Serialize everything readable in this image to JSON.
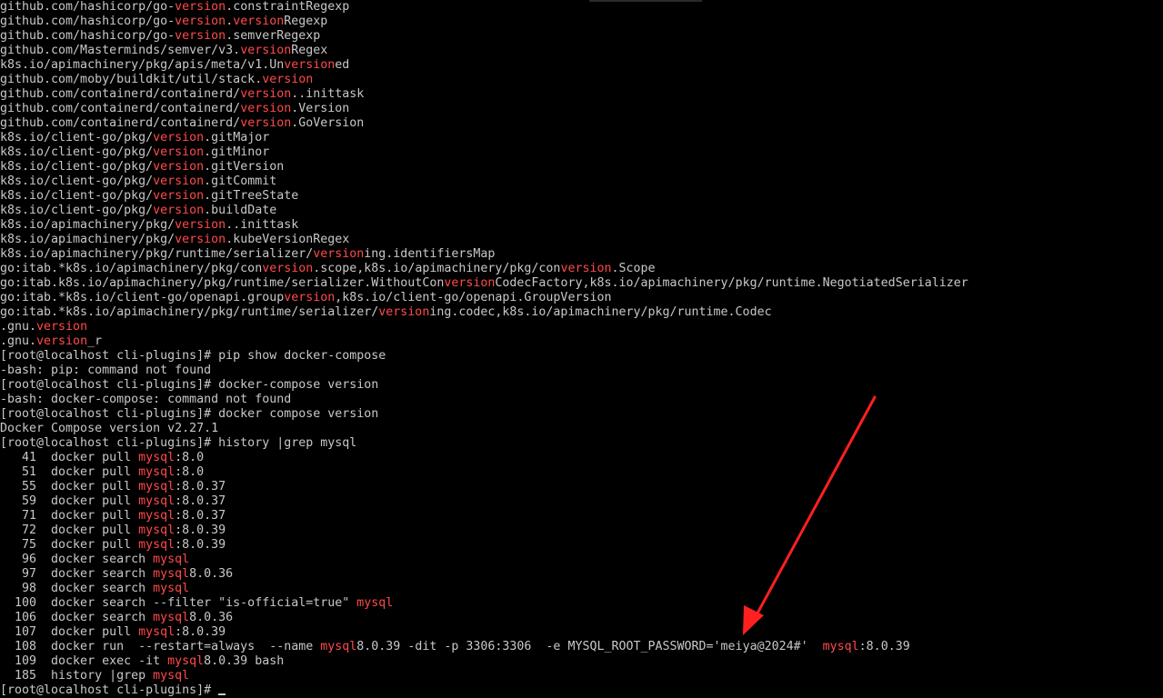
{
  "colors": {
    "background": "#000000",
    "text": "#c8c8c8",
    "highlight": "#ff4a4a",
    "arrow": "#ff2020"
  },
  "terminal": {
    "lines": [
      [
        {
          "t": "github.com/hashicorp/go-"
        },
        {
          "t": "version",
          "h": true
        },
        {
          "t": ".constraintRegexp"
        }
      ],
      [
        {
          "t": "github.com/hashicorp/go-"
        },
        {
          "t": "version",
          "h": true
        },
        {
          "t": "."
        },
        {
          "t": "version",
          "h": true
        },
        {
          "t": "Regexp"
        }
      ],
      [
        {
          "t": "github.com/hashicorp/go-"
        },
        {
          "t": "version",
          "h": true
        },
        {
          "t": ".semverRegexp"
        }
      ],
      [
        {
          "t": "github.com/Masterminds/semver/v3."
        },
        {
          "t": "version",
          "h": true
        },
        {
          "t": "Regex"
        }
      ],
      [
        {
          "t": "k8s.io/apimachinery/pkg/apis/meta/v1.Un"
        },
        {
          "t": "version",
          "h": true
        },
        {
          "t": "ed"
        }
      ],
      [
        {
          "t": "github.com/moby/buildkit/util/stack."
        },
        {
          "t": "version",
          "h": true
        }
      ],
      [
        {
          "t": "github.com/containerd/containerd/"
        },
        {
          "t": "version",
          "h": true
        },
        {
          "t": "..inittask"
        }
      ],
      [
        {
          "t": "github.com/containerd/containerd/"
        },
        {
          "t": "version",
          "h": true
        },
        {
          "t": ".Version"
        }
      ],
      [
        {
          "t": "github.com/containerd/containerd/"
        },
        {
          "t": "version",
          "h": true
        },
        {
          "t": ".GoVersion"
        }
      ],
      [
        {
          "t": "k8s.io/client-go/pkg/"
        },
        {
          "t": "version",
          "h": true
        },
        {
          "t": ".gitMajor"
        }
      ],
      [
        {
          "t": "k8s.io/client-go/pkg/"
        },
        {
          "t": "version",
          "h": true
        },
        {
          "t": ".gitMinor"
        }
      ],
      [
        {
          "t": "k8s.io/client-go/pkg/"
        },
        {
          "t": "version",
          "h": true
        },
        {
          "t": ".gitVersion"
        }
      ],
      [
        {
          "t": "k8s.io/client-go/pkg/"
        },
        {
          "t": "version",
          "h": true
        },
        {
          "t": ".gitCommit"
        }
      ],
      [
        {
          "t": "k8s.io/client-go/pkg/"
        },
        {
          "t": "version",
          "h": true
        },
        {
          "t": ".gitTreeState"
        }
      ],
      [
        {
          "t": "k8s.io/client-go/pkg/"
        },
        {
          "t": "version",
          "h": true
        },
        {
          "t": ".buildDate"
        }
      ],
      [
        {
          "t": "k8s.io/apimachinery/pkg/"
        },
        {
          "t": "version",
          "h": true
        },
        {
          "t": "..inittask"
        }
      ],
      [
        {
          "t": "k8s.io/apimachinery/pkg/"
        },
        {
          "t": "version",
          "h": true
        },
        {
          "t": ".kubeVersionRegex"
        }
      ],
      [
        {
          "t": "k8s.io/apimachinery/pkg/runtime/serializer/"
        },
        {
          "t": "version",
          "h": true
        },
        {
          "t": "ing.identifiersMap"
        }
      ],
      [
        {
          "t": "go:itab.*k8s.io/apimachinery/pkg/con"
        },
        {
          "t": "version",
          "h": true
        },
        {
          "t": ".scope,k8s.io/apimachinery/pkg/con"
        },
        {
          "t": "version",
          "h": true
        },
        {
          "t": ".Scope"
        }
      ],
      [
        {
          "t": "go:itab.k8s.io/apimachinery/pkg/runtime/serializer.WithoutCon"
        },
        {
          "t": "version",
          "h": true
        },
        {
          "t": "CodecFactory,k8s.io/apimachinery/pkg/runtime.NegotiatedSerializer"
        }
      ],
      [
        {
          "t": "go:itab.*k8s.io/client-go/openapi.group"
        },
        {
          "t": "version",
          "h": true
        },
        {
          "t": ",k8s.io/client-go/openapi.GroupVersion"
        }
      ],
      [
        {
          "t": "go:itab.*k8s.io/apimachinery/pkg/runtime/serializer/"
        },
        {
          "t": "version",
          "h": true
        },
        {
          "t": "ing.codec,k8s.io/apimachinery/pkg/runtime.Codec"
        }
      ],
      [
        {
          "t": ".gnu."
        },
        {
          "t": "version",
          "h": true
        }
      ],
      [
        {
          "t": ".gnu."
        },
        {
          "t": "version",
          "h": true
        },
        {
          "t": "_r"
        }
      ],
      [
        {
          "t": "[root@localhost cli-plugins]# pip show docker-compose"
        }
      ],
      [
        {
          "t": "-bash: pip: command not found"
        }
      ],
      [
        {
          "t": "[root@localhost cli-plugins]# docker-compose version"
        }
      ],
      [
        {
          "t": "-bash: docker-compose: command not found"
        }
      ],
      [
        {
          "t": "[root@localhost cli-plugins]# docker compose version"
        }
      ],
      [
        {
          "t": "Docker Compose version v2.27.1"
        }
      ],
      [
        {
          "t": "[root@localhost cli-plugins]# history |grep mysql"
        }
      ],
      [
        {
          "t": "   41  docker pull "
        },
        {
          "t": "mysql",
          "h": true
        },
        {
          "t": ":8.0"
        }
      ],
      [
        {
          "t": "   51  docker pull "
        },
        {
          "t": "mysql",
          "h": true
        },
        {
          "t": ":8.0"
        }
      ],
      [
        {
          "t": "   55  docker pull "
        },
        {
          "t": "mysql",
          "h": true
        },
        {
          "t": ":8.0.37"
        }
      ],
      [
        {
          "t": "   59  docker pull "
        },
        {
          "t": "mysql",
          "h": true
        },
        {
          "t": ":8.0.37"
        }
      ],
      [
        {
          "t": "   71  docker pull "
        },
        {
          "t": "mysql",
          "h": true
        },
        {
          "t": ":8.0.37"
        }
      ],
      [
        {
          "t": "   72  docker pull "
        },
        {
          "t": "mysql",
          "h": true
        },
        {
          "t": ":8.0.39"
        }
      ],
      [
        {
          "t": "   75  docker pull "
        },
        {
          "t": "mysql",
          "h": true
        },
        {
          "t": ":8.0.39"
        }
      ],
      [
        {
          "t": "   96  docker search "
        },
        {
          "t": "mysql",
          "h": true
        }
      ],
      [
        {
          "t": "   97  docker search "
        },
        {
          "t": "mysql",
          "h": true
        },
        {
          "t": "8.0.36"
        }
      ],
      [
        {
          "t": "   98  docker search "
        },
        {
          "t": "mysql",
          "h": true
        }
      ],
      [
        {
          "t": "  100  docker search --filter \"is-official=true\" "
        },
        {
          "t": "mysql",
          "h": true
        }
      ],
      [
        {
          "t": "  106  docker search "
        },
        {
          "t": "mysql",
          "h": true
        },
        {
          "t": "8.0.36"
        }
      ],
      [
        {
          "t": "  107  docker pull "
        },
        {
          "t": "mysql",
          "h": true
        },
        {
          "t": ":8.0.39"
        }
      ],
      [
        {
          "t": "  108  docker run  --restart=always  --name "
        },
        {
          "t": "mysql",
          "h": true
        },
        {
          "t": "8.0.39 -dit -p 3306:3306  -e MYSQL_ROOT_PASSWORD='meiya@2024#'  "
        },
        {
          "t": "mysql",
          "h": true
        },
        {
          "t": ":8.0.39"
        }
      ],
      [
        {
          "t": "  109  docker exec -it "
        },
        {
          "t": "mysql",
          "h": true
        },
        {
          "t": "8.0.39 bash"
        }
      ],
      [
        {
          "t": "  185  history |grep "
        },
        {
          "t": "mysql",
          "h": true
        }
      ],
      [
        {
          "t": "[root@localhost cli-plugins]# "
        }
      ]
    ]
  }
}
